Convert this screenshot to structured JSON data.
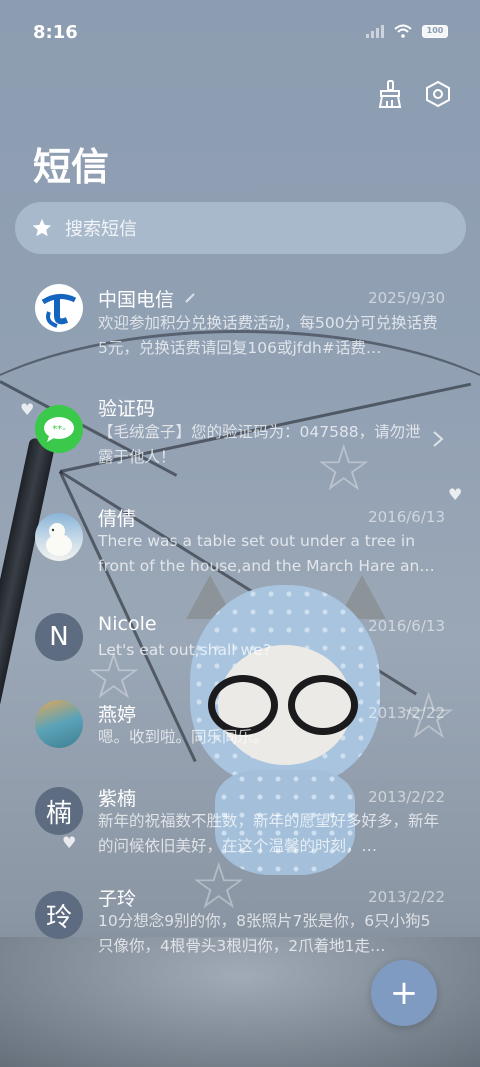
{
  "status_bar": {
    "time": "8:16",
    "battery": "100"
  },
  "header": {
    "title": "短信",
    "clean_icon": "broom-icon",
    "settings_icon": "settings-hex-icon"
  },
  "search": {
    "placeholder": "搜索短信",
    "icon": "star-icon"
  },
  "conversations": [
    {
      "name": "中国电信",
      "date": "2025/9/30",
      "preview": "欢迎参加积分兑换话费活动，每500分可兑换话费5元，兑换话费请回复106或jfdh#话费…",
      "avatar_type": "china-telecom-logo",
      "pinned_edit": true
    },
    {
      "name": "验证码",
      "date": "",
      "preview": "【毛绒盒子】您的验证码为：047588，请勿泄露于他人！",
      "avatar_type": "verification-code-icon"
    },
    {
      "name": "倩倩",
      "date": "2016/6/13",
      "preview": "There was a table set out under a tree in front of the house,and the March Hare an…",
      "avatar_type": "polar-bear-photo"
    },
    {
      "name": "Nicole",
      "date": "2016/6/13",
      "preview": "Let's eat out,shall we?",
      "avatar_letter": "N"
    },
    {
      "name": "燕婷",
      "date": "2013/2/22",
      "preview": "嗯。收到啦。同乐同乐。",
      "avatar_type": "landscape-photo"
    },
    {
      "name": "紫楠",
      "date": "2013/2/22",
      "preview": "新年的祝福数不胜数，新年的愿望好多好多，新年的问候依旧美好，在这个温馨的时刻，…",
      "avatar_letter": "楠"
    },
    {
      "name": "子玲",
      "date": "2013/2/22",
      "preview": "10分想念9别的你，8张照片7张是你，6只小狗5只像你，4根骨头3根归你，2爪着地1走…",
      "avatar_letter": "玲"
    }
  ],
  "fab": {
    "label": "+",
    "icon": "plus-icon"
  },
  "colors": {
    "fab": "#7f9bc1",
    "avatar_letter_bg": "#5e6c81",
    "telecom_blue": "#1565c0",
    "verify_green": "#3ac94a"
  }
}
